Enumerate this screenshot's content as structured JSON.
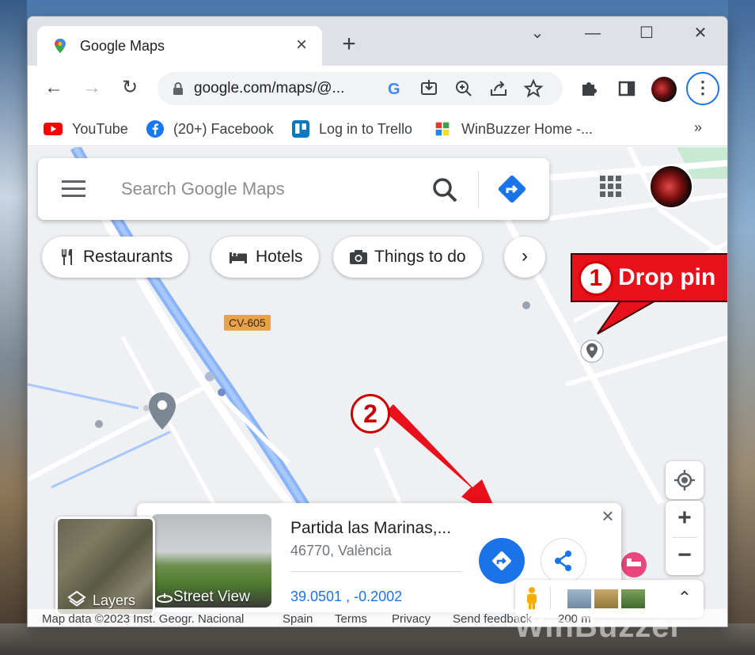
{
  "browser": {
    "tab_title": "Google Maps",
    "tab_close": "×",
    "new_tab": "+",
    "window_controls": {
      "dropdown": "⌄",
      "minimize": "—",
      "maximize": "☐",
      "close": "✕"
    },
    "url": "google.com/maps/@...",
    "nav": {
      "back": "←",
      "forward": "→",
      "reload": "↻"
    }
  },
  "bookmarks": [
    {
      "label": "YouTube",
      "icon": "youtube-icon",
      "color": "#ff0000"
    },
    {
      "label": "(20+) Facebook",
      "icon": "facebook-icon",
      "color": "#1877f2"
    },
    {
      "label": "Log in to Trello",
      "icon": "trello-icon",
      "color": "#0079bf"
    },
    {
      "label": "WinBuzzer Home -...",
      "icon": "winbuzzer-icon",
      "color": "#c9a227"
    }
  ],
  "bookmarks_more": "»",
  "maps": {
    "search_placeholder": "Search Google Maps",
    "chips": [
      {
        "label": "Restaurants",
        "icon": "fork-knife-icon"
      },
      {
        "label": "Hotels",
        "icon": "bed-icon"
      },
      {
        "label": "Things to do",
        "icon": "camera-icon"
      }
    ],
    "chips_next": "›",
    "road_label": "CV-605",
    "annotation_1": {
      "number": "1",
      "text": "Drop pin"
    },
    "annotation_2": {
      "number": "2"
    },
    "zoom_in": "+",
    "zoom_out": "−",
    "place": {
      "name": "Partida las Marinas,...",
      "address": "46770, València",
      "coordinates": "39.0501   , -0.2002",
      "street_view_label": "Street View",
      "close": "×"
    },
    "layers_label": "Layers",
    "footer": {
      "map_data": "Map data ©2023 Inst. Geogr. Nacional",
      "country": "Spain",
      "terms": "Terms",
      "privacy": "Privacy",
      "feedback": "Send feedback",
      "scale": "200 m"
    }
  },
  "watermark": "WinBuzzer",
  "colors": {
    "accent": "#1a73e8",
    "annotation": "#e8101a",
    "chrome_frame": "#dee1e6"
  }
}
